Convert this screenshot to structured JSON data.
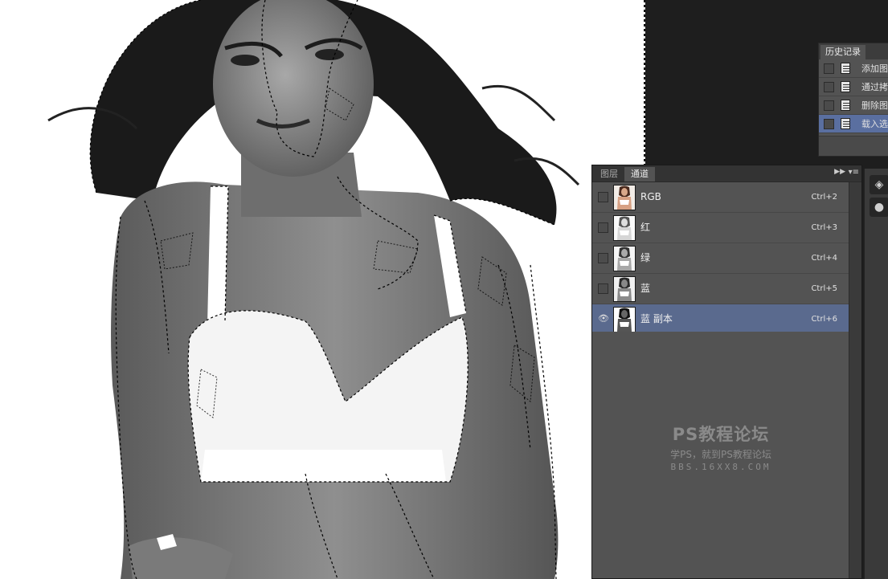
{
  "history_panel": {
    "tab_label": "历史记录",
    "items": [
      {
        "label": "添加图层蒙版"
      },
      {
        "label": "通过拷贝的图层"
      },
      {
        "label": "删除图层"
      },
      {
        "label": "载入选区",
        "selected": true
      }
    ]
  },
  "channels_panel": {
    "tabs": [
      {
        "label": "图层",
        "active": false
      },
      {
        "label": "通道",
        "active": true
      }
    ],
    "collapse_icon": "double-chevron-right",
    "menu_icon": "panel-menu",
    "channels": [
      {
        "name": "RGB",
        "shortcut": "Ctrl+2",
        "visible": false,
        "selected": false
      },
      {
        "name": "红",
        "shortcut": "Ctrl+3",
        "visible": false,
        "selected": false
      },
      {
        "name": "绿",
        "shortcut": "Ctrl+4",
        "visible": false,
        "selected": false
      },
      {
        "name": "蓝",
        "shortcut": "Ctrl+5",
        "visible": false,
        "selected": false
      },
      {
        "name": "蓝 副本",
        "shortcut": "Ctrl+6",
        "visible": true,
        "selected": true
      }
    ]
  },
  "watermark": {
    "title": "PS教程论坛",
    "subtitle": "学PS，就到PS教程论坛",
    "url": "BBS.16XX8.COM"
  },
  "dock": {
    "icons": [
      "layers-icon",
      "channels-icon"
    ]
  },
  "colors": {
    "selected_row": "#5a6a8e",
    "panel_bg": "#535353",
    "workspace_bg": "#1e1e1e"
  }
}
